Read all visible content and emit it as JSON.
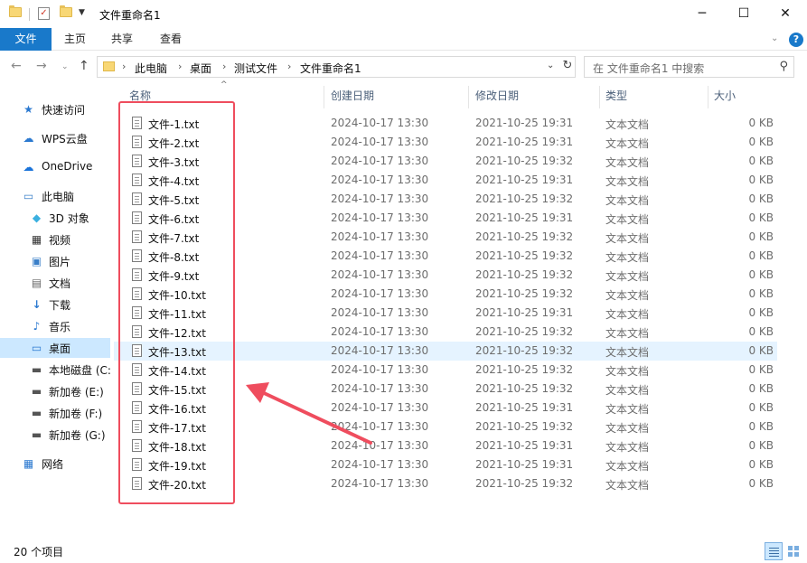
{
  "window": {
    "title": "文件重命名1",
    "minimize": "─",
    "maximize": "☐",
    "close": "✕"
  },
  "ribbon": {
    "tabs": [
      "文件",
      "主页",
      "共享",
      "查看"
    ]
  },
  "address": {
    "crumbs": [
      "此电脑",
      "桌面",
      "测试文件",
      "文件重命名1"
    ],
    "search_placeholder": "在 文件重命名1 中搜索"
  },
  "sidebar": {
    "items": [
      {
        "label": "快速访问",
        "icon": "star-icon"
      },
      {
        "label": "WPS云盘",
        "icon": "cloud-icon"
      },
      {
        "label": "OneDrive",
        "icon": "onedrive-icon"
      },
      {
        "label": "此电脑",
        "icon": "computer-icon"
      },
      {
        "label": "3D 对象",
        "icon": "cube-icon"
      },
      {
        "label": "视频",
        "icon": "video-icon"
      },
      {
        "label": "图片",
        "icon": "picture-icon"
      },
      {
        "label": "文档",
        "icon": "document-icon"
      },
      {
        "label": "下载",
        "icon": "download-icon"
      },
      {
        "label": "音乐",
        "icon": "music-icon"
      },
      {
        "label": "桌面",
        "icon": "desktop-icon"
      },
      {
        "label": "本地磁盘 (C:",
        "icon": "drive-icon"
      },
      {
        "label": "新加卷 (E:)",
        "icon": "drive-icon"
      },
      {
        "label": "新加卷 (F:)",
        "icon": "drive-icon"
      },
      {
        "label": "新加卷 (G:)",
        "icon": "drive-icon"
      },
      {
        "label": "网络",
        "icon": "network-icon"
      }
    ]
  },
  "columns": [
    "名称",
    "创建日期",
    "修改日期",
    "类型",
    "大小"
  ],
  "files": [
    {
      "name": "文件-1.txt",
      "created": "2024-10-17 13:30",
      "modified": "2021-10-25 19:31",
      "type": "文本文档",
      "size": "0 KB"
    },
    {
      "name": "文件-2.txt",
      "created": "2024-10-17 13:30",
      "modified": "2021-10-25 19:31",
      "type": "文本文档",
      "size": "0 KB"
    },
    {
      "name": "文件-3.txt",
      "created": "2024-10-17 13:30",
      "modified": "2021-10-25 19:32",
      "type": "文本文档",
      "size": "0 KB"
    },
    {
      "name": "文件-4.txt",
      "created": "2024-10-17 13:30",
      "modified": "2021-10-25 19:31",
      "type": "文本文档",
      "size": "0 KB"
    },
    {
      "name": "文件-5.txt",
      "created": "2024-10-17 13:30",
      "modified": "2021-10-25 19:32",
      "type": "文本文档",
      "size": "0 KB"
    },
    {
      "name": "文件-6.txt",
      "created": "2024-10-17 13:30",
      "modified": "2021-10-25 19:31",
      "type": "文本文档",
      "size": "0 KB"
    },
    {
      "name": "文件-7.txt",
      "created": "2024-10-17 13:30",
      "modified": "2021-10-25 19:32",
      "type": "文本文档",
      "size": "0 KB"
    },
    {
      "name": "文件-8.txt",
      "created": "2024-10-17 13:30",
      "modified": "2021-10-25 19:32",
      "type": "文本文档",
      "size": "0 KB"
    },
    {
      "name": "文件-9.txt",
      "created": "2024-10-17 13:30",
      "modified": "2021-10-25 19:32",
      "type": "文本文档",
      "size": "0 KB"
    },
    {
      "name": "文件-10.txt",
      "created": "2024-10-17 13:30",
      "modified": "2021-10-25 19:32",
      "type": "文本文档",
      "size": "0 KB"
    },
    {
      "name": "文件-11.txt",
      "created": "2024-10-17 13:30",
      "modified": "2021-10-25 19:31",
      "type": "文本文档",
      "size": "0 KB"
    },
    {
      "name": "文件-12.txt",
      "created": "2024-10-17 13:30",
      "modified": "2021-10-25 19:32",
      "type": "文本文档",
      "size": "0 KB"
    },
    {
      "name": "文件-13.txt",
      "created": "2024-10-17 13:30",
      "modified": "2021-10-25 19:32",
      "type": "文本文档",
      "size": "0 KB"
    },
    {
      "name": "文件-14.txt",
      "created": "2024-10-17 13:30",
      "modified": "2021-10-25 19:32",
      "type": "文本文档",
      "size": "0 KB"
    },
    {
      "name": "文件-15.txt",
      "created": "2024-10-17 13:30",
      "modified": "2021-10-25 19:32",
      "type": "文本文档",
      "size": "0 KB"
    },
    {
      "name": "文件-16.txt",
      "created": "2024-10-17 13:30",
      "modified": "2021-10-25 19:31",
      "type": "文本文档",
      "size": "0 KB"
    },
    {
      "name": "文件-17.txt",
      "created": "2024-10-17 13:30",
      "modified": "2021-10-25 19:32",
      "type": "文本文档",
      "size": "0 KB"
    },
    {
      "name": "文件-18.txt",
      "created": "2024-10-17 13:30",
      "modified": "2021-10-25 19:31",
      "type": "文本文档",
      "size": "0 KB"
    },
    {
      "name": "文件-19.txt",
      "created": "2024-10-17 13:30",
      "modified": "2021-10-25 19:31",
      "type": "文本文档",
      "size": "0 KB"
    },
    {
      "name": "文件-20.txt",
      "created": "2024-10-17 13:30",
      "modified": "2021-10-25 19:32",
      "type": "文本文档",
      "size": "0 KB"
    }
  ],
  "status": {
    "item_count": "20 个项目"
  },
  "colors": {
    "accent": "#1979ca",
    "selection": "#cce8ff",
    "hover": "#e5f3ff",
    "annotation": "#ef4d5e"
  }
}
